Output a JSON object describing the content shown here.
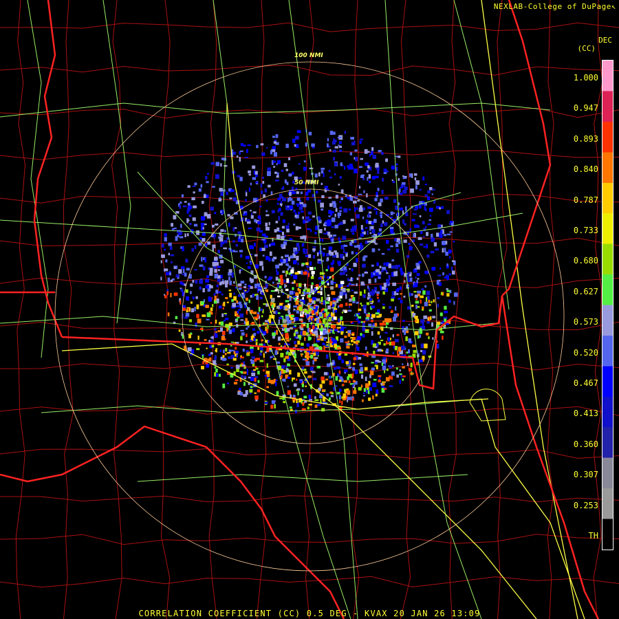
{
  "credit": "NEXLAB-College of DuPage",
  "credit_icon": "cursor-arrow-icon",
  "unit": {
    "line1": "DEC",
    "line2": "(CC)"
  },
  "ring_labels": {
    "inner": "50 NMI",
    "outer": "100 NMI"
  },
  "legend": {
    "ticks": [
      "1.000",
      "0.947",
      "0.893",
      "0.840",
      "0.787",
      "0.733",
      "0.680",
      "0.627",
      "0.573",
      "0.520",
      "0.467",
      "0.413",
      "0.360",
      "0.307",
      "0.253",
      "TH"
    ],
    "colors": [
      "#ff99cc",
      "#dd2255",
      "#ff3300",
      "#ff7700",
      "#ffcc00",
      "#eeee00",
      "#99dd00",
      "#55ee44",
      "#9999dd",
      "#5566ee",
      "#0000ff",
      "#1111cc",
      "#2222aa",
      "#888899",
      "#9a9a9a",
      "#000000"
    ]
  },
  "footer": "CORRELATION COEFFICIENT (CC) 0.5 DEG - KVAX 20 JAN 26 13:09",
  "colors": {
    "text": "#ffff33",
    "state_border": "#ff2222",
    "county_border": "#aa1111",
    "roads": "#99ee66",
    "interstate": "#ffff44",
    "range_ring": "#ffcc99"
  }
}
